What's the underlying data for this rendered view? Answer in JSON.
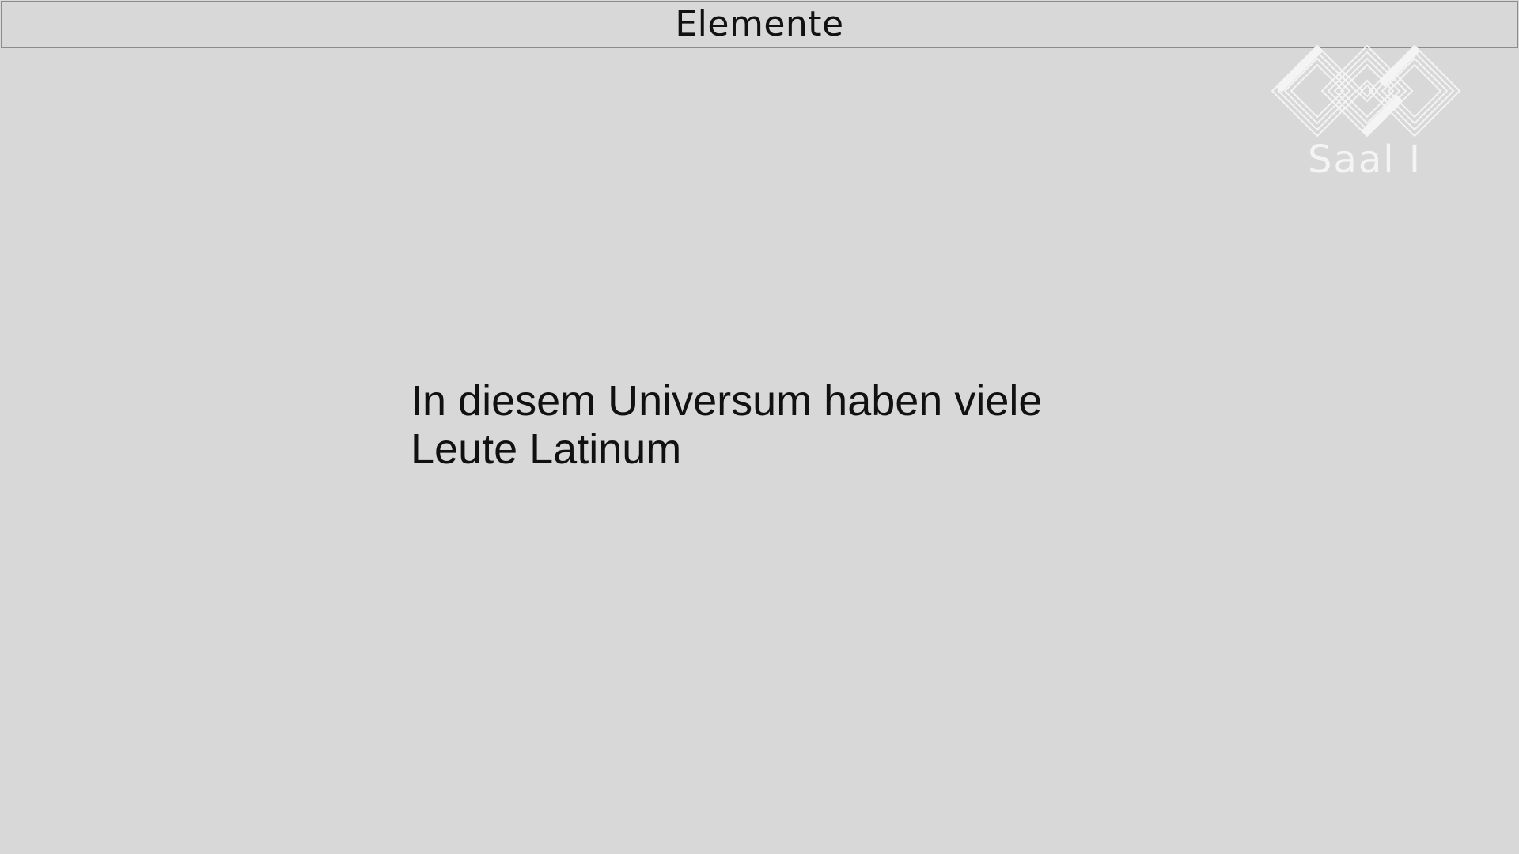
{
  "header": {
    "title": "Elemente"
  },
  "logo": {
    "label": "Saal I",
    "icon": "diamond-knot-logo-icon",
    "color": "#f4f4f4"
  },
  "content": {
    "lines": [
      "In diesem Universum haben viele",
      "Leute Latinum"
    ]
  },
  "colors": {
    "background": "#d8d8d8",
    "text": "#111111"
  }
}
